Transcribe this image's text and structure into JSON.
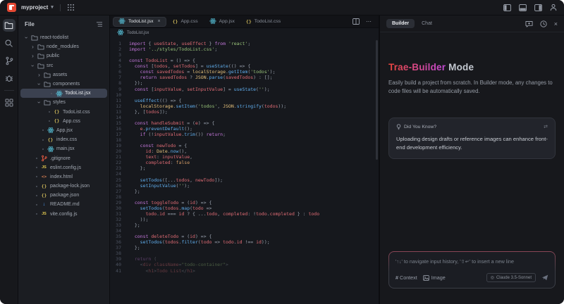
{
  "topbar": {
    "project": "myproject"
  },
  "activity": {
    "items": [
      "explorer",
      "search",
      "source-control",
      "debug",
      "extensions"
    ]
  },
  "explorer": {
    "title": "File",
    "tree": [
      {
        "label": "react-todolist",
        "kind": "folder",
        "icon": "folder",
        "depth": 0,
        "expanded": true
      },
      {
        "label": "node_modules",
        "kind": "folder",
        "icon": "folder",
        "depth": 1,
        "expanded": false
      },
      {
        "label": "public",
        "kind": "folder",
        "icon": "folder",
        "depth": 1,
        "expanded": false
      },
      {
        "label": "src",
        "kind": "folder",
        "icon": "folder",
        "depth": 1,
        "expanded": true
      },
      {
        "label": "assets",
        "kind": "folder",
        "icon": "folder",
        "depth": 2,
        "expanded": false
      },
      {
        "label": "components",
        "kind": "folder",
        "icon": "folder",
        "depth": 2,
        "expanded": true
      },
      {
        "label": "TodoList.jsx",
        "kind": "file",
        "icon": "react",
        "depth": 3,
        "selected": true
      },
      {
        "label": "styles",
        "kind": "folder",
        "icon": "folder",
        "depth": 2,
        "expanded": true
      },
      {
        "label": "TodoList.css",
        "kind": "file",
        "icon": "braces",
        "depth": 3
      },
      {
        "label": "App.css",
        "kind": "file",
        "icon": "braces",
        "depth": 3
      },
      {
        "label": "App.jsx",
        "kind": "file",
        "icon": "react",
        "depth": 2
      },
      {
        "label": "index.css",
        "kind": "file",
        "icon": "braces",
        "depth": 2
      },
      {
        "label": "main.jsx",
        "kind": "file",
        "icon": "react",
        "depth": 2
      },
      {
        "label": ".gitignore",
        "kind": "file",
        "icon": "git",
        "depth": 1
      },
      {
        "label": "eslint.config.js",
        "kind": "file",
        "icon": "js",
        "depth": 1
      },
      {
        "label": "index.html",
        "kind": "file",
        "icon": "html",
        "depth": 1
      },
      {
        "label": "package-lock.json",
        "kind": "file",
        "icon": "braces",
        "depth": 1
      },
      {
        "label": "package.json",
        "kind": "file",
        "icon": "braces",
        "depth": 1
      },
      {
        "label": "README.md",
        "kind": "file",
        "icon": "md",
        "depth": 1
      },
      {
        "label": "vite.config.js",
        "kind": "file",
        "icon": "js",
        "depth": 1
      }
    ]
  },
  "editor": {
    "tabs": [
      {
        "label": "TodoList.jsx",
        "icon": "react",
        "active": true
      },
      {
        "label": "App.css",
        "icon": "braces",
        "active": false
      },
      {
        "label": "App.jsx",
        "icon": "react",
        "active": false
      },
      {
        "label": "TodoList.css",
        "icon": "braces",
        "active": false
      }
    ],
    "breadcrumb": {
      "icon": "react",
      "label": "TodoList.jsx"
    },
    "dim_from": 39,
    "code": [
      "import { useState, useEffect } from 'react';",
      "import '../styles/TodoList.css';",
      "",
      "const TodoList = () => {",
      "  const [todos, setTodos] = useState(() => {",
      "    const savedTodos = localStorage.getItem('todos');",
      "    return savedTodos ? JSON.parse(savedTodos) : [];",
      "  });",
      "  const [inputValue, setInputValue] = useState('');",
      "",
      "  useEffect(() => {",
      "    localStorage.setItem('todos', JSON.stringify(todos));",
      "  }, [todos]);",
      "",
      "  const handleSubmit = (e) => {",
      "    e.preventDefault();",
      "    if (!inputValue.trim()) return;",
      "",
      "    const newTodo = {",
      "      id: Date.now(),",
      "      text: inputValue,",
      "      completed: false",
      "    };",
      "",
      "    setTodos([...todos, newTodo]);",
      "    setInputValue('');",
      "  };",
      "",
      "  const toggleTodo = (id) => {",
      "    setTodos(todos.map(todo =>",
      "      todo.id === id ? { ...todo, completed: !todo.completed } : todo",
      "    ));",
      "  };",
      "",
      "  const deleteTodo = (id) => {",
      "    setTodos(todos.filter(todo => todo.id !== id));",
      "  };",
      "",
      "  return (",
      "    <div className=\"todo-container\">",
      "      <h1>Todo List</h1>"
    ]
  },
  "builder": {
    "tabs": [
      {
        "label": "Builder",
        "active": true
      },
      {
        "label": "Chat",
        "active": false
      }
    ],
    "title_accent": "Trae-Builder",
    "title_rest": "Mode",
    "subtitle": "Easily build a project from scratch. In Builder mode, any changes to code files will be automatically saved.",
    "tip": {
      "title": "Did You Know?",
      "body": "Uploading design drafts or reference images can enhance front-end development efficiency."
    },
    "input": {
      "placeholder": "'↑↓' to navigate input history, '⇧↵' to insert a new line",
      "context_label": "Context",
      "image_label": "Image",
      "model": "Claude 3.5-Sonnet"
    }
  },
  "colors": {
    "logo": "#e54832",
    "accent_from": "#e8453c",
    "accent_to": "#c44bd9",
    "react_icon": "#58c4dc",
    "selection_row": "#3b4150"
  }
}
